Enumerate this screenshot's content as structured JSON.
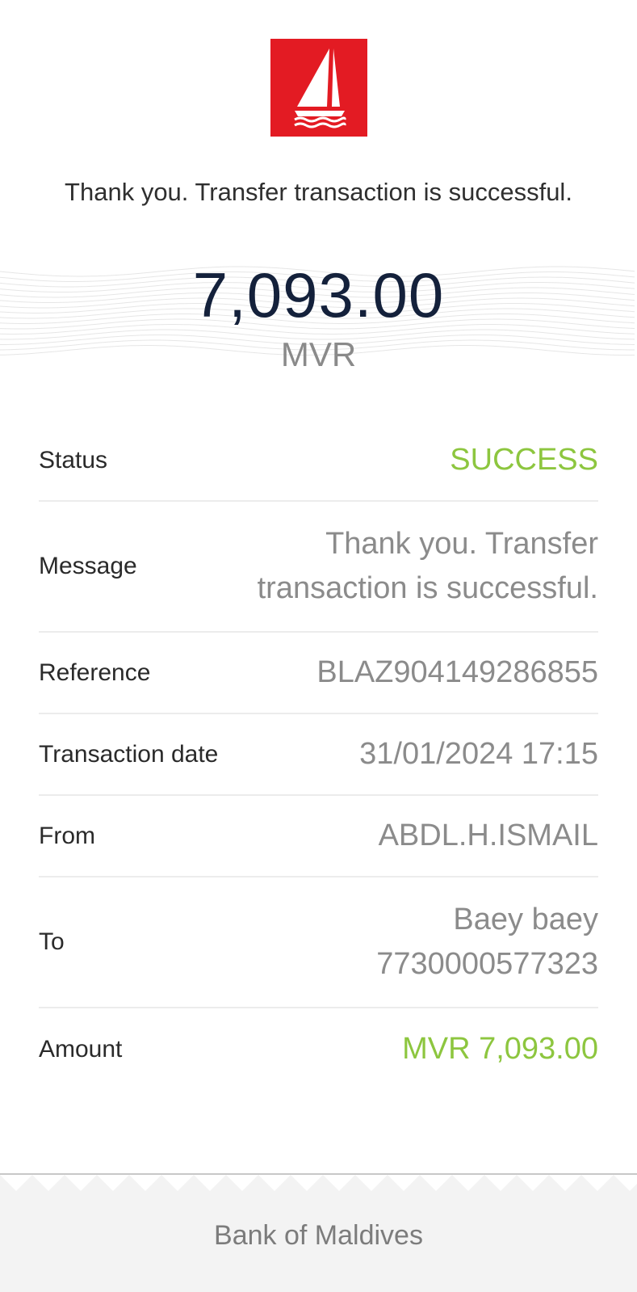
{
  "header": {
    "logo": "bank-of-maldives-sailboat-logo",
    "message": "Thank you. Transfer transaction is successful."
  },
  "summary": {
    "amount": "7,093.00",
    "currency": "MVR"
  },
  "details": {
    "status": {
      "label": "Status",
      "value": "SUCCESS"
    },
    "message": {
      "label": "Message",
      "value_line1": "Thank you. Transfer",
      "value_line2": "transaction is successful."
    },
    "reference": {
      "label": "Reference",
      "value": "BLAZ904149286855"
    },
    "transaction_date": {
      "label": "Transaction date",
      "value": "31/01/2024 17:15"
    },
    "from": {
      "label": "From",
      "value": "ABDL.H.ISMAIL"
    },
    "to": {
      "label": "To",
      "value_line1": "Baey baey",
      "value_line2": "7730000577323"
    },
    "amount": {
      "label": "Amount",
      "value": "MVR 7,093.00"
    }
  },
  "footer": {
    "text": "Bank of Maldives"
  },
  "colors": {
    "brand_red": "#e31b23",
    "success_green": "#8dc63f",
    "amount_navy": "#14213b"
  }
}
